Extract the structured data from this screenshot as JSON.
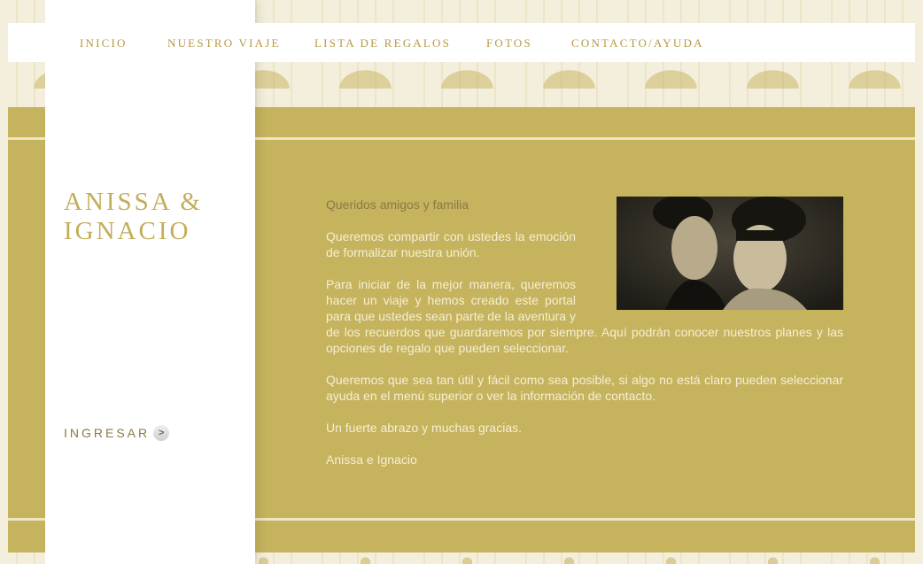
{
  "nav": {
    "items": [
      {
        "label": "INICIO",
        "name": "nav-inicio"
      },
      {
        "label": "NUESTRO VIAJE",
        "name": "nav-nuestro-viaje"
      },
      {
        "label": "LISTA DE REGALOS",
        "name": "nav-lista-de-regalos"
      },
      {
        "label": "FOTOS",
        "name": "nav-fotos"
      },
      {
        "label": "CONTACTO/AYUDA",
        "name": "nav-contacto-ayuda"
      }
    ]
  },
  "sidebar": {
    "title_line1": "ANISSA &",
    "title_line2": "IGNACIO",
    "enter_label": "INGRESAR",
    "enter_arrow": ">"
  },
  "letter": {
    "greeting": "Queridos amigos y familia",
    "paragraphs": [
      "Queremos compartir con ustedes la emoción de formalizar nuestra unión.",
      "Para iniciar de la mejor manera, queremos hacer un viaje y hemos creado este portal para que ustedes sean parte de la aventura y de los recuerdos que guardaremos por siempre. Aquí podrán conocer nuestros planes y las opciones de regalo que pueden seleccionar.",
      "Queremos que sea tan útil y fácil como sea posible, si algo no está claro pueden seleccionar ayuda en el menú superior o ver la información de contacto.",
      "Un fuerte abrazo y muchas gracias."
    ],
    "signature": "Anissa e Ignacio"
  },
  "colors": {
    "gold_panel": "#c5b35e",
    "gold_text": "#b59a45",
    "cream_text": "#f6efd2"
  }
}
